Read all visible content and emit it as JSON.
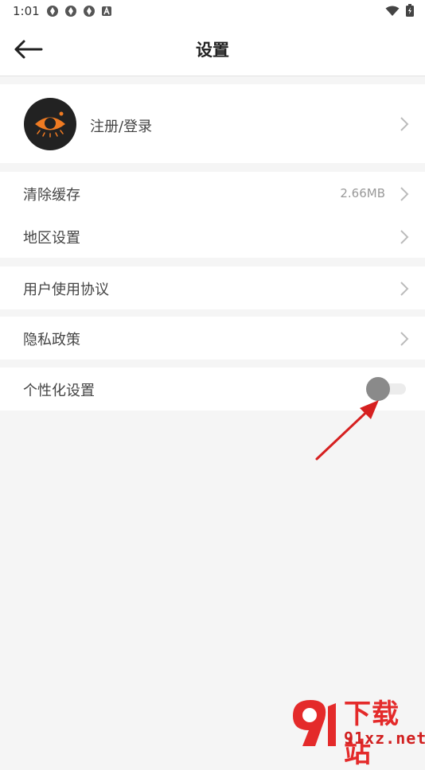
{
  "status_bar": {
    "time": "1:01"
  },
  "app_bar": {
    "title": "设置"
  },
  "account": {
    "login_label": "注册/登录"
  },
  "cache": {
    "label": "清除缓存",
    "value": "2.66MB"
  },
  "region": {
    "label": "地区设置"
  },
  "agreement": {
    "label": "用户使用协议"
  },
  "privacy": {
    "label": "隐私政策"
  },
  "personalization": {
    "label": "个性化设置",
    "enabled": false
  },
  "watermark": {
    "title": "下载站",
    "url": "91xz.net"
  },
  "colors": {
    "background": "#f5f5f5",
    "surface": "#ffffff",
    "avatar_accent": "#f07b22",
    "annotation_arrow": "#d62020",
    "watermark": "#e42a2a",
    "toggle_knob": "#8a8a8a"
  },
  "icons": [
    "back-arrow-icon",
    "chevron-right-icon",
    "wifi-icon",
    "battery-icon",
    "eye-logo-icon"
  ]
}
